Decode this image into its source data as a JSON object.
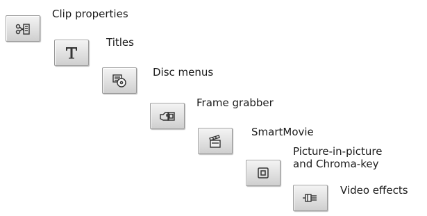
{
  "tools": [
    {
      "label": "Clip properties",
      "icon": "clip-properties-icon"
    },
    {
      "label": "Titles",
      "icon": "titles-icon"
    },
    {
      "label": "Disc menus",
      "icon": "disc-menus-icon"
    },
    {
      "label": "Frame grabber",
      "icon": "frame-grabber-icon"
    },
    {
      "label": "SmartMovie",
      "icon": "smartmovie-icon"
    },
    {
      "label_lines": [
        "Picture-in-picture",
        "and Chroma-key"
      ],
      "icon": "picture-in-picture-icon"
    },
    {
      "label": "Video effects",
      "icon": "video-effects-icon"
    }
  ],
  "colors": {
    "button_face": "#e6e6e6",
    "icon_stroke": "#333333",
    "text": "#1a1a1a"
  }
}
